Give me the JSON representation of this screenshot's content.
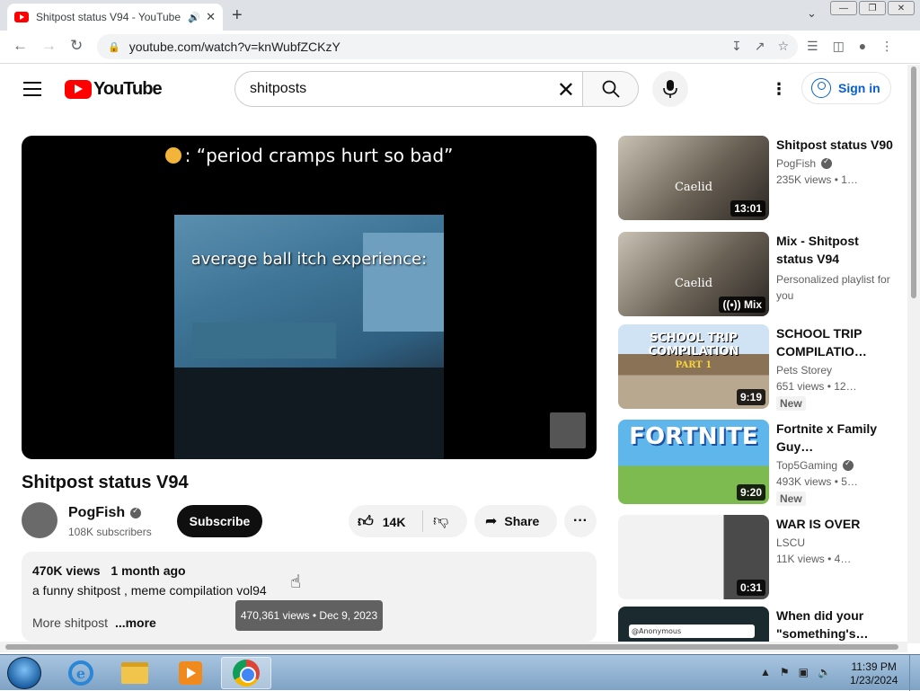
{
  "browser": {
    "tab_title": "Shitpost status V94 - YouTube",
    "tab_close": "✕",
    "new_tab": "+",
    "url": "youtube.com/watch?v=knWubfZCKzY",
    "back": "←",
    "forward": "→",
    "reload": "↻"
  },
  "header": {
    "logo_text": "YouTube",
    "search_value": "shitposts",
    "sign_in": "Sign in"
  },
  "player": {
    "caption_top": "“period cramps hurt so bad”",
    "caption_mid": "average ball itch experience:"
  },
  "video": {
    "title": "Shitpost status V94",
    "channel": "PogFish",
    "subscribers": "108K subscribers",
    "subscribe_label": "Subscribe",
    "likes": "14K",
    "share_label": "Share",
    "views": "470K views",
    "age": "1 month ago",
    "description": "a funny shitpost , meme compilation vol94",
    "description_tail": "More shitpost",
    "more_label": "...more",
    "tooltip": "470,361 views • Dec 9, 2023"
  },
  "recommendations": [
    {
      "title": "Shitpost status V90",
      "channel": "PogFish",
      "verified": true,
      "meta": "235K views • 1…",
      "duration": "13:01",
      "thumb_text": "Caelid",
      "new": false
    },
    {
      "title": "Mix - Shitpost status V94",
      "channel": "Personalized playlist for you",
      "verified": false,
      "meta": "",
      "duration": "Mix",
      "thumb_text": "Caelid",
      "new": false
    },
    {
      "title": "SCHOOL TRIP COMPILATIO…",
      "channel": "Pets Storey",
      "verified": false,
      "meta": "651 views • 12…",
      "duration": "9:19",
      "thumb_text": "SCHOOL TRIP COMPILATION",
      "thumb_sub": "PART 1",
      "new": true,
      "new_label": "New"
    },
    {
      "title": "Fortnite x Family Guy…",
      "channel": "Top5Gaming",
      "verified": true,
      "meta": "493K views • 5…",
      "duration": "9:20",
      "thumb_text": "FORTNITE",
      "new": true,
      "new_label": "New"
    },
    {
      "title": "WAR IS OVER",
      "channel": "LSCU",
      "verified": false,
      "meta": "11K views • 4…",
      "duration": "0:31",
      "thumb_text": "",
      "new": false
    },
    {
      "title": "When did your \"something's…",
      "channel": "",
      "verified": false,
      "meta": "",
      "duration": "",
      "thumb_text": "@Anonymous",
      "new": false
    }
  ],
  "taskbar": {
    "time": "11:39 PM",
    "date": "1/23/2024"
  },
  "colors": {
    "youtube_red": "#ff0000",
    "link_blue": "#065fd4",
    "subscribe_bg": "#0f0f0f"
  }
}
